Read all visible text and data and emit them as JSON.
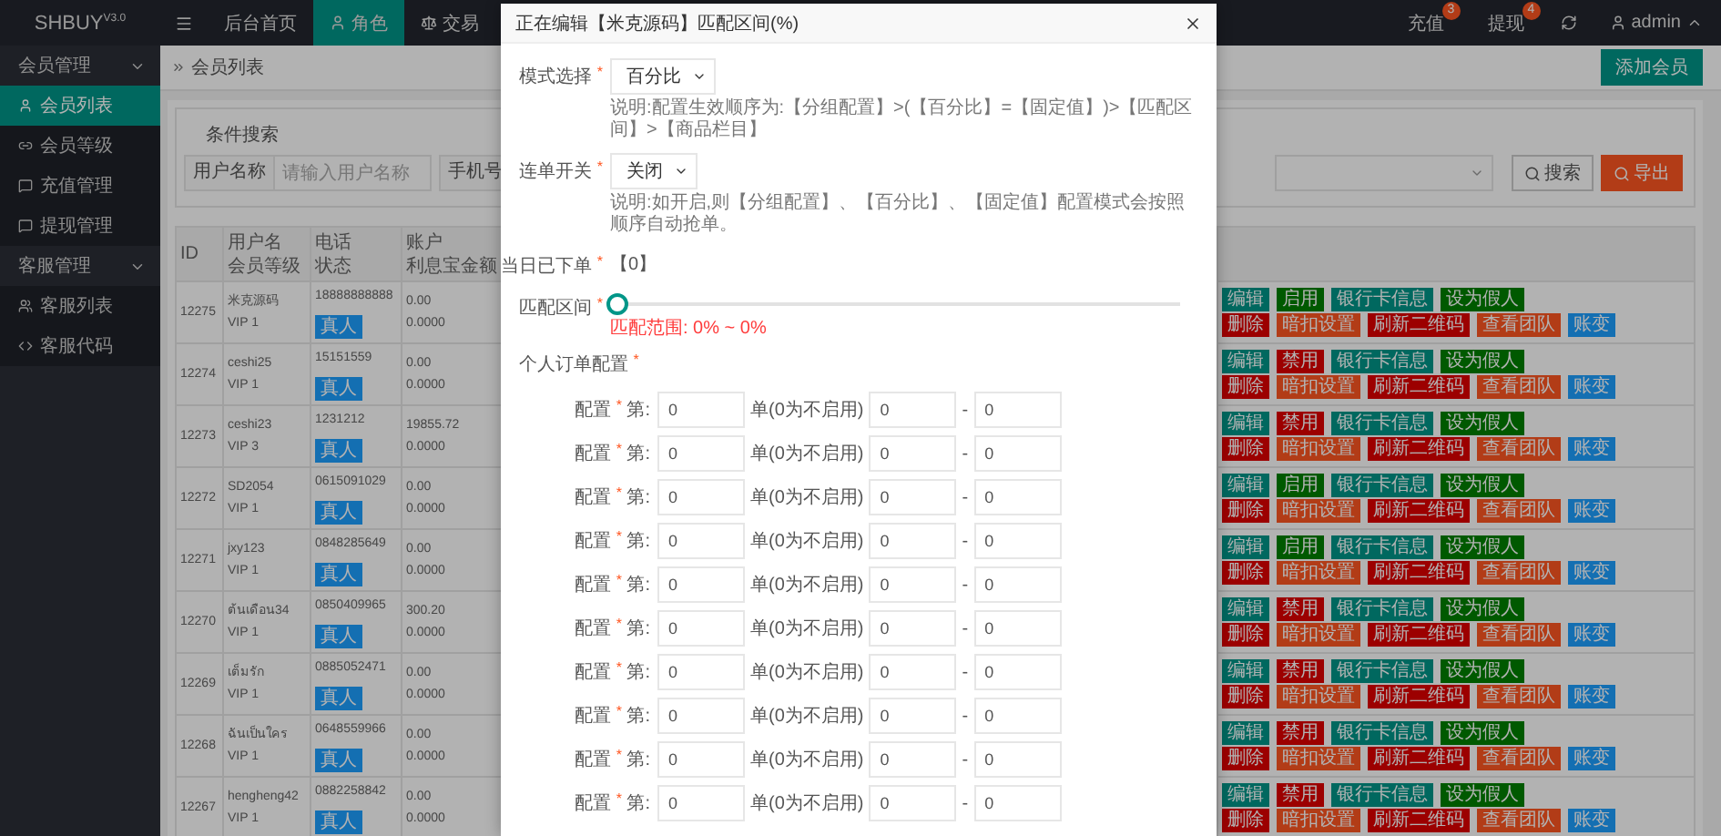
{
  "sidebar": {
    "logo": "SHBUY$^{V3.0}$",
    "groups": [
      {
        "label": "会员管理",
        "expanded": true,
        "items": [
          {
            "label": "会员列表",
            "selected": true
          },
          {
            "label": "会员等级",
            "selected": false
          },
          {
            "label": "充值管理",
            "selected": false
          },
          {
            "label": "提现管理",
            "selected": false
          }
        ]
      },
      {
        "label": "客服管理",
        "expanded": true,
        "items": [
          {
            "label": "客服列表",
            "selected": false
          },
          {
            "label": "客服代码",
            "selected": false
          }
        ]
      }
    ]
  },
  "topbar": {
    "tabs": [
      {
        "label": "后台首页",
        "selected": false
      },
      {
        "label": "角色",
        "selected": true
      },
      {
        "label": "交易",
        "selected": false
      }
    ],
    "notices": [
      {
        "label": "充值",
        "count": "3"
      },
      {
        "label": "提现",
        "count": "4"
      }
    ],
    "user": "admin"
  },
  "page": {
    "breadcrumb": "会员列表",
    "add_button": "添加会员"
  },
  "search": {
    "legend": "条件搜索",
    "field_label": "用户名称",
    "placeholder": "请输入用户名称",
    "next_label": "手机号",
    "search_button": "搜索",
    "export_button": "导出"
  },
  "table": {
    "columns": [
      {
        "line_1": "ID"
      },
      {
        "line_1": "用户名",
        "line_2": "会员等级"
      },
      {
        "line_1": "电话",
        "line_2": "状态"
      },
      {
        "line_1": "账户",
        "line_2": "利息宝金额"
      }
    ],
    "rows": [
      {
        "id": "12275",
        "name": "米克源码",
        "vip": "VIP 1",
        "phone": "18888888888",
        "status": "真人",
        "balance": "0.00",
        "interest": "0.0000",
        "actions_top": [
          {
            "label": "编辑",
            "kind": "primary"
          },
          {
            "label": "启用",
            "kind": "success"
          },
          {
            "label": "银行卡信息",
            "kind": "primary"
          },
          {
            "label": "设为假人",
            "kind": "success"
          }
        ],
        "actions_bottom": [
          {
            "label": "删除",
            "kind": "danger"
          },
          {
            "label": "暗扣设置",
            "kind": "warm"
          },
          {
            "label": "刷新二维码",
            "kind": "danger"
          },
          {
            "label": "查看团队",
            "kind": "warm"
          },
          {
            "label": "账变",
            "kind": "info"
          }
        ]
      },
      {
        "id": "12274",
        "name": "ceshi25",
        "vip": "VIP 1",
        "phone": "15151559",
        "status": "真人",
        "balance": "0.00",
        "interest": "0.0000",
        "actions_top": [
          {
            "label": "编辑",
            "kind": "primary"
          },
          {
            "label": "禁用",
            "kind": "danger"
          },
          {
            "label": "银行卡信息",
            "kind": "primary"
          },
          {
            "label": "设为假人",
            "kind": "success"
          }
        ],
        "actions_bottom": [
          {
            "label": "删除",
            "kind": "danger"
          },
          {
            "label": "暗扣设置",
            "kind": "warm"
          },
          {
            "label": "刷新二维码",
            "kind": "danger"
          },
          {
            "label": "查看团队",
            "kind": "warm"
          },
          {
            "label": "账变",
            "kind": "info"
          }
        ]
      },
      {
        "id": "12273",
        "name": "ceshi23",
        "vip": "VIP 3",
        "phone": "1231212",
        "status": "真人",
        "balance": "19855.72",
        "interest": "0.0000",
        "actions_top": [
          {
            "label": "编辑",
            "kind": "primary"
          },
          {
            "label": "禁用",
            "kind": "danger"
          },
          {
            "label": "银行卡信息",
            "kind": "primary"
          },
          {
            "label": "设为假人",
            "kind": "success"
          }
        ],
        "actions_bottom": [
          {
            "label": "删除",
            "kind": "danger"
          },
          {
            "label": "暗扣设置",
            "kind": "warm"
          },
          {
            "label": "刷新二维码",
            "kind": "danger"
          },
          {
            "label": "查看团队",
            "kind": "warm"
          },
          {
            "label": "账变",
            "kind": "info"
          }
        ]
      },
      {
        "id": "12272",
        "name": "SD2054",
        "vip": "VIP 1",
        "phone": "0615091029",
        "status": "真人",
        "balance": "0.00",
        "interest": "0.0000",
        "actions_top": [
          {
            "label": "编辑",
            "kind": "primary"
          },
          {
            "label": "启用",
            "kind": "success"
          },
          {
            "label": "银行卡信息",
            "kind": "primary"
          },
          {
            "label": "设为假人",
            "kind": "success"
          }
        ],
        "actions_bottom": [
          {
            "label": "删除",
            "kind": "danger"
          },
          {
            "label": "暗扣设置",
            "kind": "warm"
          },
          {
            "label": "刷新二维码",
            "kind": "danger"
          },
          {
            "label": "查看团队",
            "kind": "warm"
          },
          {
            "label": "账变",
            "kind": "info"
          }
        ]
      },
      {
        "id": "12271",
        "name": "jxy123",
        "vip": "VIP 1",
        "phone": "0848285649",
        "status": "真人",
        "balance": "0.00",
        "interest": "0.0000",
        "actions_top": [
          {
            "label": "编辑",
            "kind": "primary"
          },
          {
            "label": "启用",
            "kind": "success"
          },
          {
            "label": "银行卡信息",
            "kind": "primary"
          },
          {
            "label": "设为假人",
            "kind": "success"
          }
        ],
        "actions_bottom": [
          {
            "label": "删除",
            "kind": "danger"
          },
          {
            "label": "暗扣设置",
            "kind": "warm"
          },
          {
            "label": "刷新二维码",
            "kind": "danger"
          },
          {
            "label": "查看团队",
            "kind": "warm"
          },
          {
            "label": "账变",
            "kind": "info"
          }
        ]
      },
      {
        "id": "12270",
        "name": "ต้นเดือน34",
        "vip": "VIP 1",
        "phone": "0850409965",
        "status": "真人",
        "balance": "300.20",
        "interest": "0.0000",
        "actions_top": [
          {
            "label": "编辑",
            "kind": "primary"
          },
          {
            "label": "禁用",
            "kind": "danger"
          },
          {
            "label": "银行卡信息",
            "kind": "primary"
          },
          {
            "label": "设为假人",
            "kind": "success"
          }
        ],
        "actions_bottom": [
          {
            "label": "删除",
            "kind": "danger"
          },
          {
            "label": "暗扣设置",
            "kind": "warm"
          },
          {
            "label": "刷新二维码",
            "kind": "danger"
          },
          {
            "label": "查看团队",
            "kind": "warm"
          },
          {
            "label": "账变",
            "kind": "info"
          }
        ]
      },
      {
        "id": "12269",
        "name": "เต็มรัก",
        "vip": "VIP 1",
        "phone": "0885052471",
        "status": "真人",
        "balance": "0.00",
        "interest": "0.0000",
        "actions_top": [
          {
            "label": "编辑",
            "kind": "primary"
          },
          {
            "label": "禁用",
            "kind": "danger"
          },
          {
            "label": "银行卡信息",
            "kind": "primary"
          },
          {
            "label": "设为假人",
            "kind": "success"
          }
        ],
        "actions_bottom": [
          {
            "label": "删除",
            "kind": "danger"
          },
          {
            "label": "暗扣设置",
            "kind": "warm"
          },
          {
            "label": "刷新二维码",
            "kind": "danger"
          },
          {
            "label": "查看团队",
            "kind": "warm"
          },
          {
            "label": "账变",
            "kind": "info"
          }
        ]
      },
      {
        "id": "12268",
        "name": "ฉันเป็นใคร",
        "vip": "VIP 1",
        "phone": "0648559966",
        "status": "真人",
        "balance": "0.00",
        "interest": "0.0000",
        "actions_top": [
          {
            "label": "编辑",
            "kind": "primary"
          },
          {
            "label": "禁用",
            "kind": "danger"
          },
          {
            "label": "银行卡信息",
            "kind": "primary"
          },
          {
            "label": "设为假人",
            "kind": "success"
          }
        ],
        "actions_bottom": [
          {
            "label": "删除",
            "kind": "danger"
          },
          {
            "label": "暗扣设置",
            "kind": "warm"
          },
          {
            "label": "刷新二维码",
            "kind": "danger"
          },
          {
            "label": "查看团队",
            "kind": "warm"
          },
          {
            "label": "账变",
            "kind": "info"
          }
        ]
      },
      {
        "id": "12267",
        "name": "hengheng42",
        "vip": "VIP 1",
        "phone": "0882258842",
        "status": "真人",
        "balance": "0.00",
        "interest": "0.0000",
        "actions_top": [
          {
            "label": "编辑",
            "kind": "primary"
          },
          {
            "label": "禁用",
            "kind": "danger"
          },
          {
            "label": "银行卡信息",
            "kind": "primary"
          },
          {
            "label": "设为假人",
            "kind": "success"
          }
        ],
        "actions_bottom": [
          {
            "label": "删除",
            "kind": "danger"
          },
          {
            "label": "暗扣设置",
            "kind": "warm"
          },
          {
            "label": "刷新二维码",
            "kind": "danger"
          },
          {
            "label": "查看团队",
            "kind": "warm"
          },
          {
            "label": "账变",
            "kind": "info"
          }
        ]
      }
    ]
  },
  "modal": {
    "title": "正在编辑【米克源码】匹配区间(%)",
    "fields": [
      {
        "kind": "select",
        "label": "模式选择",
        "marker": "*",
        "value": "百分比",
        "hint": "说明:配置生效顺序为:【分组配置】>(【百分比】=【固定值】)>【匹配区间】>【商品栏目】"
      },
      {
        "kind": "select",
        "label": "连单开关",
        "marker": "*",
        "value": "关闭",
        "hint": "说明:如开启,则【分组配置】、【百分比】、【固定值】配置模式会按照顺序自动抢单。"
      },
      {
        "kind": "text",
        "label": "当日已下单",
        "marker": "*",
        "value": "【0】"
      },
      {
        "kind": "slider",
        "label": "匹配区间",
        "marker": "*",
        "level": 0,
        "reading": "匹配范围: 0% ~ 0%"
      },
      {
        "kind": "heading",
        "label": "个人订单配置",
        "marker": "*"
      }
    ],
    "order_rows": [
      {
        "label": "配置",
        "marker": "*",
        "prefix": "第:",
        "count": "0",
        "unit": "单(0为不启用)",
        "min": "0",
        "separator": "-",
        "max": "0"
      },
      {
        "label": "配置",
        "marker": "*",
        "prefix": "第:",
        "count": "0",
        "unit": "单(0为不启用)",
        "min": "0",
        "separator": "-",
        "max": "0"
      },
      {
        "label": "配置",
        "marker": "*",
        "prefix": "第:",
        "count": "0",
        "unit": "单(0为不启用)",
        "min": "0",
        "separator": "-",
        "max": "0"
      },
      {
        "label": "配置",
        "marker": "*",
        "prefix": "第:",
        "count": "0",
        "unit": "单(0为不启用)",
        "min": "0",
        "separator": "-",
        "max": "0"
      },
      {
        "label": "配置",
        "marker": "*",
        "prefix": "第:",
        "count": "0",
        "unit": "单(0为不启用)",
        "min": "0",
        "separator": "-",
        "max": "0"
      },
      {
        "label": "配置",
        "marker": "*",
        "prefix": "第:",
        "count": "0",
        "unit": "单(0为不启用)",
        "min": "0",
        "separator": "-",
        "max": "0"
      },
      {
        "label": "配置",
        "marker": "*",
        "prefix": "第:",
        "count": "0",
        "unit": "单(0为不启用)",
        "min": "0",
        "separator": "-",
        "max": "0"
      },
      {
        "label": "配置",
        "marker": "*",
        "prefix": "第:",
        "count": "0",
        "unit": "单(0为不启用)",
        "min": "0",
        "separator": "-",
        "max": "0"
      },
      {
        "label": "配置",
        "marker": "*",
        "prefix": "第:",
        "count": "0",
        "unit": "单(0为不启用)",
        "min": "0",
        "separator": "-",
        "max": "0"
      },
      {
        "label": "配置",
        "marker": "*",
        "prefix": "第:",
        "count": "0",
        "unit": "单(0为不启用)",
        "min": "0",
        "separator": "-",
        "max": "0"
      }
    ]
  }
}
